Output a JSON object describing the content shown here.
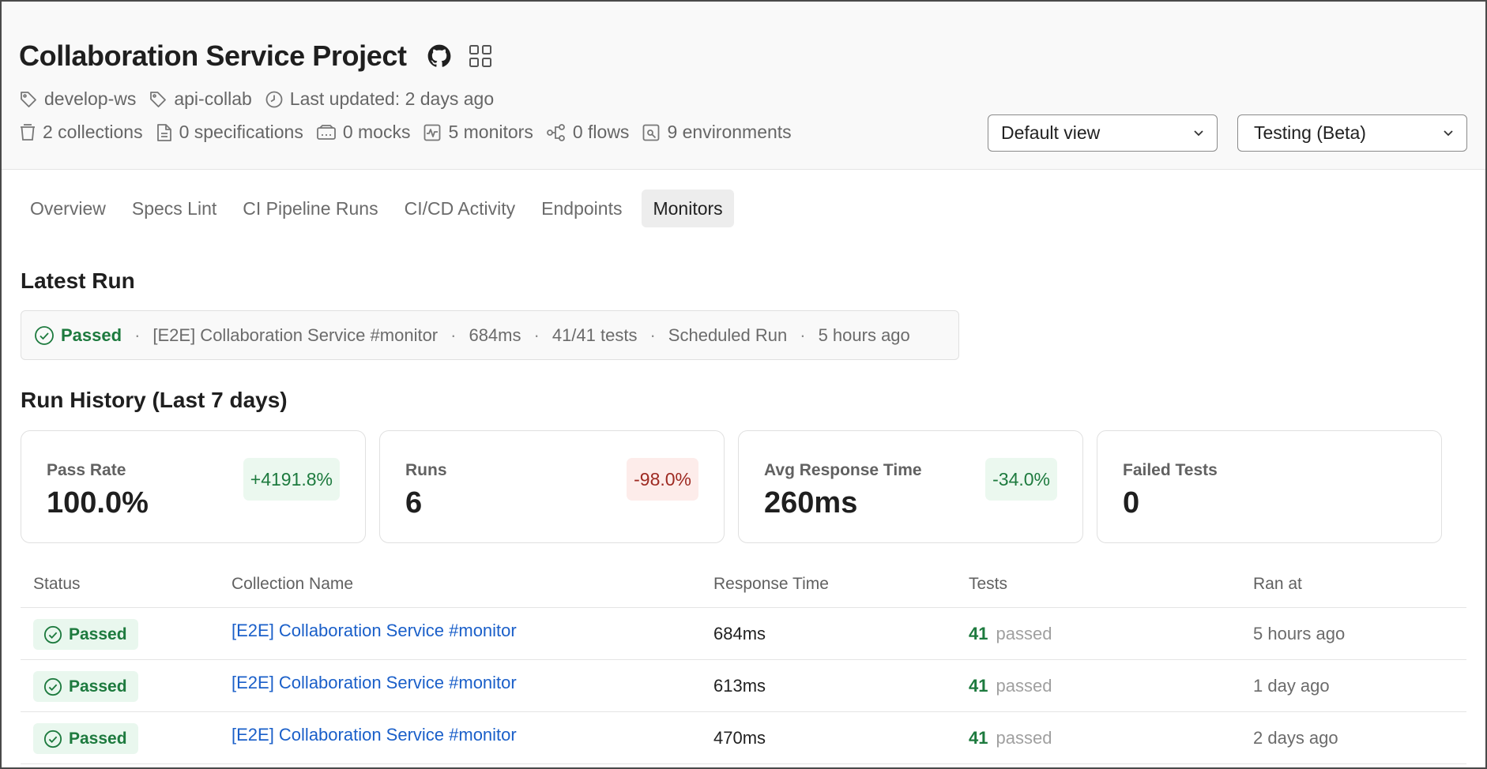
{
  "header": {
    "title": "Collaboration Service Project",
    "icons": [
      "github-icon",
      "grid-icon"
    ],
    "meta_row1": [
      {
        "icon": "tag-icon",
        "text": "develop-ws"
      },
      {
        "icon": "tag-icon",
        "text": "api-collab"
      },
      {
        "icon": "clock-icon",
        "text": "Last updated: 2 days ago"
      }
    ],
    "meta_row2": [
      {
        "icon": "collection-icon",
        "text": "2 collections"
      },
      {
        "icon": "document-icon",
        "text": "0 specifications"
      },
      {
        "icon": "mock-icon",
        "text": "0 mocks"
      },
      {
        "icon": "monitor-icon",
        "text": "5 monitors"
      },
      {
        "icon": "flow-icon",
        "text": "0 flows"
      },
      {
        "icon": "environment-icon",
        "text": "9 environments"
      }
    ],
    "view_select": "Default view",
    "mode_select": "Testing (Beta)"
  },
  "tabs": [
    "Overview",
    "Specs Lint",
    "CI Pipeline Runs",
    "CI/CD Activity",
    "Endpoints",
    "Monitors"
  ],
  "active_tab": "Monitors",
  "latest_run": {
    "section_title": "Latest Run",
    "status": "Passed",
    "collection": "[E2E] Collaboration Service #monitor",
    "duration": "684ms",
    "tests": "41/41 tests",
    "type": "Scheduled Run",
    "when": "5 hours ago",
    "separator": "·"
  },
  "run_history": {
    "section_title": "Run History (Last 7 days)",
    "cards": [
      {
        "label": "Pass Rate",
        "value": "100.0%",
        "delta": "+4191.8%",
        "trend": "up"
      },
      {
        "label": "Runs",
        "value": "6",
        "delta": "-98.0%",
        "trend": "down"
      },
      {
        "label": "Avg Response Time",
        "value": "260ms",
        "delta": "-34.0%",
        "trend": "up"
      },
      {
        "label": "Failed Tests",
        "value": "0",
        "delta": "",
        "trend": "none"
      }
    ]
  },
  "table": {
    "columns": [
      "Status",
      "Collection Name",
      "Response Time",
      "Tests",
      "Ran at"
    ],
    "rows": [
      {
        "status": "Passed",
        "collection": "[E2E] Collaboration Service #monitor",
        "response_time": "684ms",
        "tests_count": "41",
        "tests_word": "passed",
        "ran_at": "5 hours ago"
      },
      {
        "status": "Passed",
        "collection": "[E2E] Collaboration Service #monitor",
        "response_time": "613ms",
        "tests_count": "41",
        "tests_word": "passed",
        "ran_at": "1 day ago"
      },
      {
        "status": "Passed",
        "collection": "[E2E] Collaboration Service #monitor",
        "response_time": "470ms",
        "tests_count": "41",
        "tests_word": "passed",
        "ran_at": "2 days ago"
      }
    ]
  },
  "colors": {
    "success": "#1d7a3e",
    "success_bg": "#e9f7ee",
    "danger": "#9e2a22",
    "danger_bg": "#fdecea",
    "link": "#1a5fc9",
    "header_bg": "#f9f9f9"
  }
}
